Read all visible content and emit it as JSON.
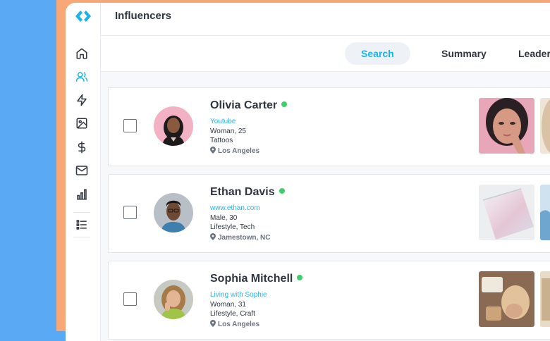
{
  "app": {
    "title": "Influencers"
  },
  "colors": {
    "accent": "#1ab3ea",
    "verified": "#3ecf6c",
    "background_blue": "#5aa9f5",
    "background_orange": "#f8a876"
  },
  "sidebar": {
    "items": [
      {
        "icon": "home-icon"
      },
      {
        "icon": "users-icon",
        "active": true
      },
      {
        "icon": "lightning-icon"
      },
      {
        "icon": "image-icon"
      },
      {
        "icon": "dollar-icon"
      },
      {
        "icon": "mail-icon"
      },
      {
        "icon": "bar-chart-icon"
      },
      {
        "icon": "list-icon"
      }
    ]
  },
  "tabs": [
    {
      "label": "Search",
      "active": true
    },
    {
      "label": "Summary"
    },
    {
      "label": "Leader"
    }
  ],
  "influencers": [
    {
      "name": "Olivia Carter",
      "link": "Youtube",
      "line1": "Woman, 25",
      "line2": "Tattoos",
      "location": "Los Angeles",
      "verified": true
    },
    {
      "name": "Ethan Davis",
      "link": "www.ethan.com",
      "line1": "Male, 30",
      "line2": "Lifestyle, Tech",
      "location": "Jamestown, NC",
      "verified": true
    },
    {
      "name": "Sophia Mitchell",
      "link": "Living with Sophie",
      "line1": "Woman, 31",
      "line2": "Lifestyle, Craft",
      "location": "Los Angeles",
      "verified": true
    }
  ]
}
